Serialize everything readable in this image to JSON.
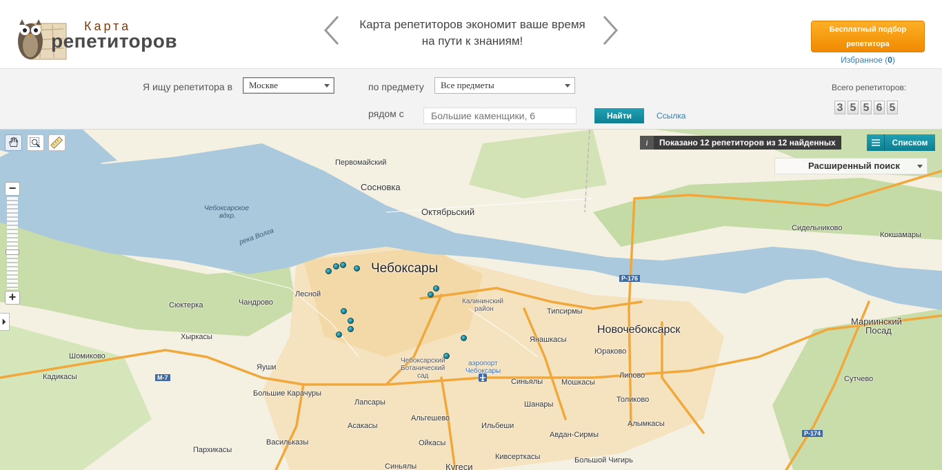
{
  "header": {
    "logo_small": "Карта",
    "logo_big": "репетиторов",
    "slogan_line1": "Карта репетиторов экономит ваше время",
    "slogan_line2": "на пути к знаниям!",
    "promo_line1": "Бесплатный подбор",
    "promo_line2": "репетитора",
    "favorites_label": "Избранное",
    "favorites_open": "(",
    "favorites_count": "0",
    "favorites_close": ")"
  },
  "search": {
    "city_label": "Я ищу репетитора в",
    "city_value": "Москве",
    "subject_label": "по предмету",
    "subject_value": "Все предметы",
    "near_label": "рядом с",
    "address_placeholder": "Большие каменщики, 6",
    "find_button": "Найти",
    "link_label": "Ссылка",
    "total_label": "Всего репетиторов:",
    "total_digits": [
      "3",
      "5",
      "5",
      "6",
      "5"
    ]
  },
  "map": {
    "shown_text": "Показано 12 репетиторов из 12 найденных",
    "info_glyph": "i",
    "list_button": "Списком",
    "advanced_search": "Расширенный поиск",
    "zoom_in": "+",
    "zoom_out": "−",
    "places": {
      "pervomaysky": "Первомайский",
      "sosnovka": "Сосновка",
      "oktyabrsky": "Октябрьский",
      "cheboksary": "Чебоксары",
      "reservoir1": "Чебоксарское",
      "reservoir2": "вдхр.",
      "volga": "река Волга",
      "lesnoy": "Лесной",
      "syuterka": "Сюктерка",
      "chandrovo": "Чандрово",
      "hyrkasy": "Хыркасы",
      "shomikovo": "Шомиково",
      "kadikasy": "Кадикасы",
      "yushi": "Яуши",
      "bolshie_karachury": "Большие Карачуры",
      "lapsary": "Лапсары",
      "asakasy": "Асакасы",
      "algeshevo": "Альгешево",
      "vasilkasy": "Васильказы",
      "parkhikasy": "Пархикасы",
      "oykasy": "Ойкасы",
      "ilbeshi": "Ильбеши",
      "kalininsky1": "Калининский",
      "kalininsky2": "район",
      "botanic1": "Чебоксарский",
      "botanic2": "Ботанический",
      "botanic3": "сад",
      "airport1": "аэропорт",
      "airport2": "Чебоксары",
      "tipsirmy": "Типсирмы",
      "yanashkasy": "Янашкасы",
      "novocheboksarsk": "Новочебоксарск",
      "yurakovo": "Юраково",
      "sinyaly": "Синьялы",
      "moshkasy": "Мошкасы",
      "lipovo": "Липово",
      "shanary": "Шанары",
      "tolikovo": "Толиково",
      "alymkasy": "Алымкасы",
      "avdan_sirmy": "Авдан-Сирмы",
      "kivserkasy": "Кивсерткасы",
      "bolshoy_chigir": "Большой Чигирь",
      "sinyaly2": "Синьялы",
      "kugesi": "Кугеси",
      "sidelnikovo": "Сидельниково",
      "koshmarly": "Кокшамары",
      "mariinsky1": "Мариинский",
      "mariinsky2": "Посад",
      "sutchevo": "Сутчево"
    },
    "roads": {
      "r176": "Р-176",
      "m7": "М-7",
      "r174": "Р-174"
    }
  },
  "colors": {
    "accent_teal": "#12899b",
    "promo_orange": "#f59a10",
    "water": "#a9c8dc",
    "forest": "#c7dca5",
    "city": "#f4e3c0",
    "road": "#f0a83c"
  }
}
